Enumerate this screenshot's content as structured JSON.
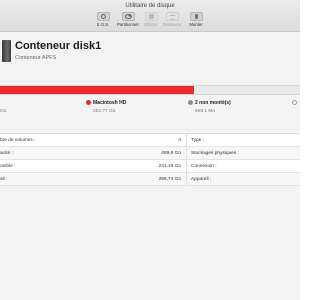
{
  "window": {
    "title": "Utilitaire de disque"
  },
  "toolbar": {
    "buttons": [
      {
        "label": "S.O.S.",
        "icon": "stethoscope-icon",
        "enabled": true
      },
      {
        "label": "Partitionner",
        "icon": "pie-icon",
        "enabled": true
      },
      {
        "label": "Effacer",
        "icon": "erase-icon",
        "enabled": false
      },
      {
        "label": "Restaurer",
        "icon": "restore-icon",
        "enabled": false
      },
      {
        "label": "Monter",
        "icon": "mount-icon",
        "enabled": true
      }
    ]
  },
  "header": {
    "title": "Conteneur disk1",
    "subtitle": "Conteneur APFS"
  },
  "usage": {
    "used_fraction": 0.645,
    "colors": {
      "used": "#eb2a2f",
      "free": "#e9e9e9",
      "other": "#8e8e8e"
    }
  },
  "legend": {
    "items": [
      {
        "name": "",
        "size": "Go"
      },
      {
        "name": "Macintosh HD",
        "size": "252,77 Go",
        "color": "#eb2a2f"
      },
      {
        "name": "2 non monté(s)",
        "size": "658,1 Mo",
        "color": "#8e8e8e"
      }
    ]
  },
  "table": {
    "left": [
      {
        "key": "bre de volumes :",
        "value": "4"
      },
      {
        "key": "acité :",
        "value": "499,9 Go"
      },
      {
        "key": "onible :",
        "value": "241,18 Go"
      },
      {
        "key": "sé :",
        "value": "258,74 Go"
      }
    ],
    "right": [
      {
        "key": "Type :"
      },
      {
        "key": "Stockages physiques :"
      },
      {
        "key": "Connexion :"
      },
      {
        "key": "Appareil :"
      }
    ]
  }
}
